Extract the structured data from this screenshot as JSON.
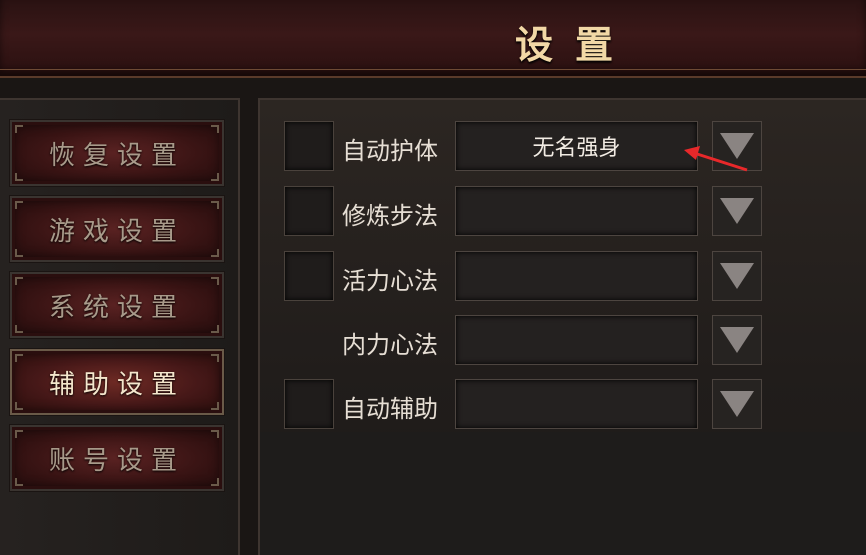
{
  "header": {
    "title": "设置"
  },
  "menu": [
    {
      "label": "恢复设置",
      "active": false
    },
    {
      "label": "游戏设置",
      "active": false
    },
    {
      "label": "系统设置",
      "active": false
    },
    {
      "label": "辅助设置",
      "active": true
    },
    {
      "label": "账号设置",
      "active": false
    }
  ],
  "settings": [
    {
      "label": "自动护体",
      "value": "无名强身",
      "has_checkbox": true
    },
    {
      "label": "修炼步法",
      "value": "",
      "has_checkbox": true
    },
    {
      "label": "活力心法",
      "value": "",
      "has_checkbox": true
    },
    {
      "label": "内力心法",
      "value": "",
      "has_checkbox": false
    },
    {
      "label": "自动辅助",
      "value": "",
      "has_checkbox": true
    }
  ],
  "icons": {
    "dropdown": "triangle-down-icon"
  },
  "colors": {
    "title": "#f2d8a6",
    "annotation_arrow": "#e8282a"
  }
}
